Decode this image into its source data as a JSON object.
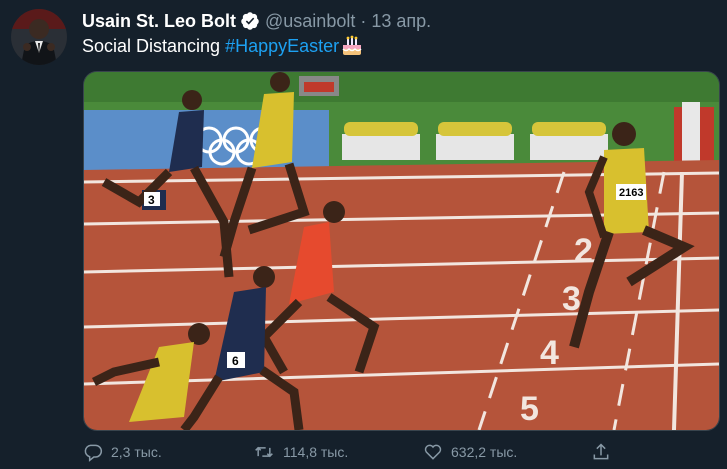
{
  "tweet": {
    "author": {
      "display_name": "Usain St. Leo Bolt",
      "handle": "@usainbolt",
      "separator": "·",
      "date": "13 апр.",
      "verified_icon": "verified-badge-icon"
    },
    "text": "Social Distancing",
    "hashtag": "#HappyEaster",
    "emoji": "birthday-cake-emoji",
    "media": {
      "lane_numbers": [
        "2",
        "3",
        "4",
        "5"
      ],
      "bib_numbers": [
        "3",
        "2163",
        "6"
      ]
    },
    "actions": {
      "reply_count": "2,3 тыс.",
      "retweet_count": "114,8 тыс.",
      "like_count": "632,2 тыс."
    }
  },
  "colors": {
    "background": "#15202b",
    "secondary_text": "#8899a6",
    "link": "#1da1f2",
    "track": "#b5543a",
    "grass": "#4a8a3a"
  }
}
